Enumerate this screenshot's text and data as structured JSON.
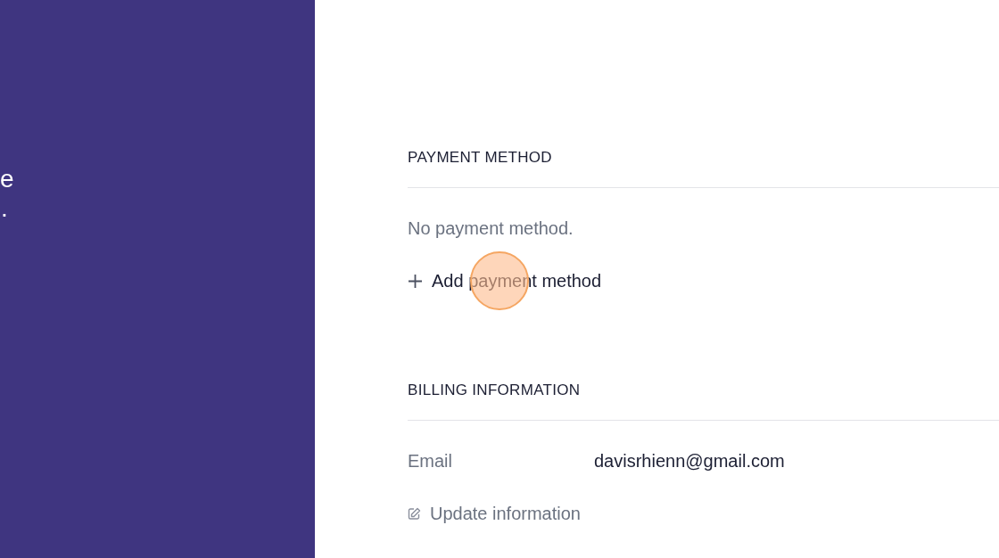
{
  "side_panel": {
    "fragments": [
      "e",
      "."
    ]
  },
  "payment_method": {
    "heading": "PAYMENT METHOD",
    "empty_text": "No payment method.",
    "add_link": "Add payment method",
    "click_indicator": true
  },
  "billing_information": {
    "heading": "BILLING INFORMATION",
    "fields": [
      {
        "label": "Email",
        "value": "davisrhienn@gmail.com"
      }
    ],
    "update_link": "Update information"
  }
}
